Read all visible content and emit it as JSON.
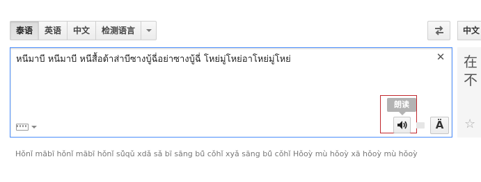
{
  "source_languages": [
    {
      "label": "泰语",
      "active": true
    },
    {
      "label": "英语",
      "active": false
    },
    {
      "label": "中文",
      "active": false
    },
    {
      "label": "检测语言",
      "active": false
    }
  ],
  "target_language": {
    "label": "中文"
  },
  "source": {
    "text": "หนีมาบี หนีมาบี หนีสื้อด้าส่าบีซางบู้ฉี่อย่าซางบู้ฉี่ โหย่มู่โหย่อาโหย่มู่โหย่",
    "transliteration": "Hǒnǐ mābī hǒnǐ mābī hǒnǐ sǔ̂qǔ xdǎ sǎ bī sāng bū̂ cǒhǐ xyǎ sāng bū̂ cǒhǐ Hǒoỳ mù hǒoỳ xā hǒoỳ mù hǒoỳ"
  },
  "listen_tooltip": "朗读",
  "special_chars_label": "Ä",
  "target": {
    "text": "在不"
  },
  "icons": {
    "clear": "close-icon",
    "keyboard": "keyboard-icon",
    "swap": "swap-languages-icon",
    "listen": "speaker-icon",
    "star": "star-icon"
  },
  "colors": {
    "focus_border": "#4d90fe",
    "highlight_border": "#c0262c",
    "tooltip_bg": "#b3b3b3"
  }
}
